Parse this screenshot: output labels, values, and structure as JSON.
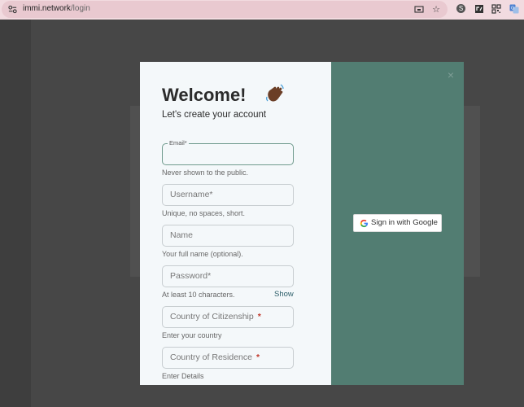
{
  "browser": {
    "url_host": "immi.network",
    "url_path": "/login",
    "icons": [
      "tune-icon",
      "cast-icon",
      "star-icon",
      "skype-icon",
      "extension-icon",
      "qr-icon",
      "translate-icon"
    ]
  },
  "modal": {
    "title": "Welcome!",
    "subtitle": "Let's create your account",
    "close_label": "×",
    "fields": {
      "email": {
        "label": "Email*",
        "value": "",
        "hint": "Never shown to the public."
      },
      "username": {
        "placeholder": "Username*",
        "hint": "Unique, no spaces, short."
      },
      "name": {
        "placeholder": "Name",
        "hint": "Your full name (optional)."
      },
      "password": {
        "placeholder": "Password*",
        "hint": "At least 10 characters.",
        "show_label": "Show"
      },
      "citizenship": {
        "placeholder": "Country of Citizenship",
        "required_mark": "*",
        "hint": "Enter your country"
      },
      "residence": {
        "placeholder": "Country of Residence",
        "required_mark": "*",
        "hint": "Enter Details"
      }
    },
    "google_button_label": "Sign in with Google"
  },
  "colors": {
    "accent_panel": "#527d72",
    "form_bg": "#f4f8fa",
    "required": "#c0392b",
    "link": "#2d5f6a"
  }
}
